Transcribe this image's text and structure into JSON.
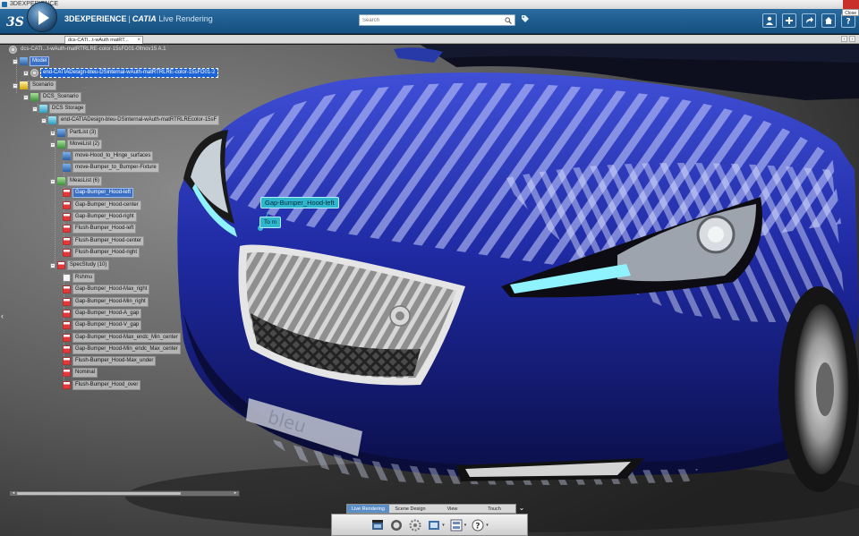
{
  "os_window": {
    "title": "3DEXPERIENCE",
    "close_tooltip": "Close"
  },
  "header": {
    "brand_3d": "3DEXPERIENCE",
    "separator": "|",
    "brand_catia": "CATIA",
    "app_name": "Live Rendering",
    "search_placeholder": "Search",
    "tools": [
      "user-icon",
      "add-icon",
      "share-icon",
      "home-icon",
      "help-icon"
    ]
  },
  "tab": {
    "label": "dcs-CATI...t-wAuth matRT..."
  },
  "tree": {
    "root": "dcs-CATI...t-wAuth-matRTRLRE-color-15sFD01-0fmov15 A.1",
    "model": "Model",
    "model_item": "end-CATIADesign-bleu-DSinternal-wAuth-matRTRLRE-color-15sFD01-2",
    "scenario": "Scenario",
    "dcs_scenario": "DCS_Scenario",
    "dcs_storage": "DCS Storage",
    "storage_item": "end-CATIADesign-bleu-DSinternal-wAuth-matRTRLREcolor-15sF",
    "partlist": "PartList (3)",
    "movelist": "MoveList (2)",
    "moves": [
      "move-Hood_to_Hinge_surfaces",
      "move-Bumper_to_Bumper-Fixture"
    ],
    "measlist": "MeasList (6)",
    "meas": [
      "Gap-Bumper_Hood-left",
      "Gap-Bumper_Hood-center",
      "Gap-Bumper_Hood-right",
      "Flush-Bumper_Hood-left",
      "Flush-Bumper_Hood-center",
      "Flush-Bumper_Hood-right"
    ],
    "specstudy": "SpecStudy (10)",
    "specs": [
      "Rshmu",
      "Gap-Bumper_Hood-Max_right",
      "Gap-Bumper_Hood-Min_right",
      "Gap-Bumper_Hood-A_gap",
      "Gap-Bumper_Hood-V_gap",
      "Gap-Bumper_Hood-Max_endc_Min_center",
      "Gap-Bumper_Hood-Min_endc_Max_center",
      "Flush-Bumper_Hood-Max_under",
      "Nominal",
      "Flush-Bumper_Hood_over"
    ]
  },
  "viewport": {
    "callout_gap": "Gap-Bumper_Hood-left",
    "callout_to": "To m",
    "license_plate": "bleu"
  },
  "action_tabs": [
    {
      "label": "Live Rendering",
      "active": true
    },
    {
      "label": "Scene Design",
      "active": false
    },
    {
      "label": "View",
      "active": false
    },
    {
      "label": "Touch",
      "active": false
    }
  ],
  "action_bar_icons": [
    "render-icon",
    "material-icon",
    "settings-icon",
    "camera-icon",
    "layout-icon",
    "help-icon"
  ],
  "colors": {
    "header_blue": "#1b5f96",
    "selection": "#3a6fc4",
    "callout": "#2fb6cf",
    "car_paint": "#1f2aa3"
  }
}
